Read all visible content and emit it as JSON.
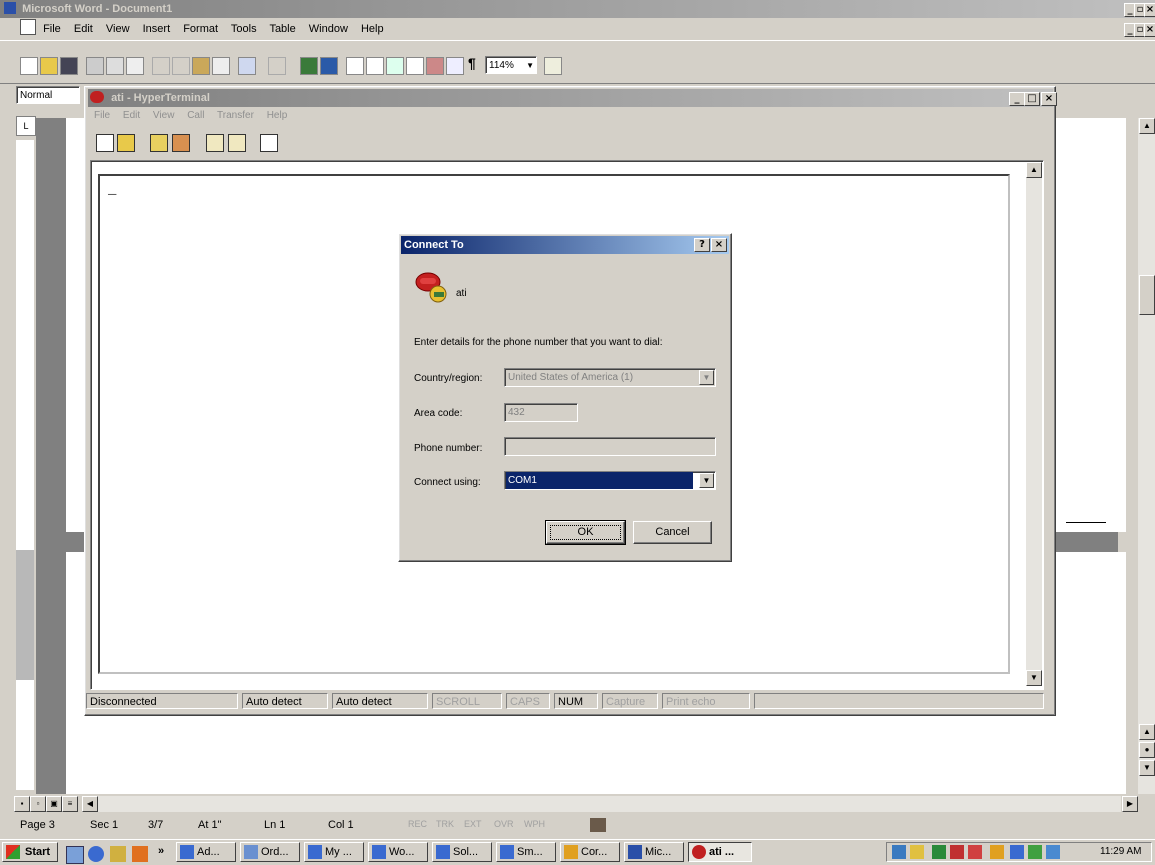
{
  "word": {
    "title": "Microsoft Word - Document1",
    "menu": [
      "File",
      "Edit",
      "View",
      "Insert",
      "Format",
      "Tools",
      "Table",
      "Window",
      "Help"
    ],
    "style_box": "Normal",
    "zoom": "114%",
    "statusbar": {
      "page": "Page 3",
      "sec": "Sec 1",
      "pages": "3/7",
      "at": "At 1\"",
      "ln": "Ln 1",
      "col": "Col 1",
      "rec": "REC",
      "trk": "TRK",
      "ext": "EXT",
      "ovr": "OVR",
      "wph": "WPH"
    }
  },
  "hyperterminal": {
    "title": "ati - HyperTerminal",
    "menu": [
      "File",
      "Edit",
      "View",
      "Call",
      "Transfer",
      "Help"
    ],
    "cursor": "_",
    "status": {
      "connection": "Disconnected",
      "detect1": "Auto detect",
      "detect2": "Auto detect",
      "scroll": "SCROLL",
      "caps": "CAPS",
      "num": "NUM",
      "capture": "Capture",
      "print_echo": "Print echo"
    }
  },
  "dialog": {
    "title": "Connect To",
    "help_btn": "?",
    "close_btn": "×",
    "connection_name": "ati",
    "instruction": "Enter details for the phone number that you want to dial:",
    "country_label": "Country/region:",
    "country_value": "United States of America (1)",
    "area_label": "Area code:",
    "area_value": "432",
    "phone_label": "Phone number:",
    "phone_value": "",
    "connect_label": "Connect using:",
    "connect_value": "COM1",
    "ok": "OK",
    "cancel": "Cancel"
  },
  "taskbar": {
    "start": "Start",
    "more": "»",
    "buttons": [
      "Ad...",
      "Ord...",
      "My ...",
      "Wo...",
      "Sol...",
      "Sm...",
      "Cor...",
      "Mic...",
      "ati ..."
    ],
    "clock": "11:29 AM"
  },
  "colors": {
    "title_active": "#0a246a",
    "title_inactive": "#808080",
    "selection": "#0a246a",
    "face": "#d4d0c8"
  }
}
